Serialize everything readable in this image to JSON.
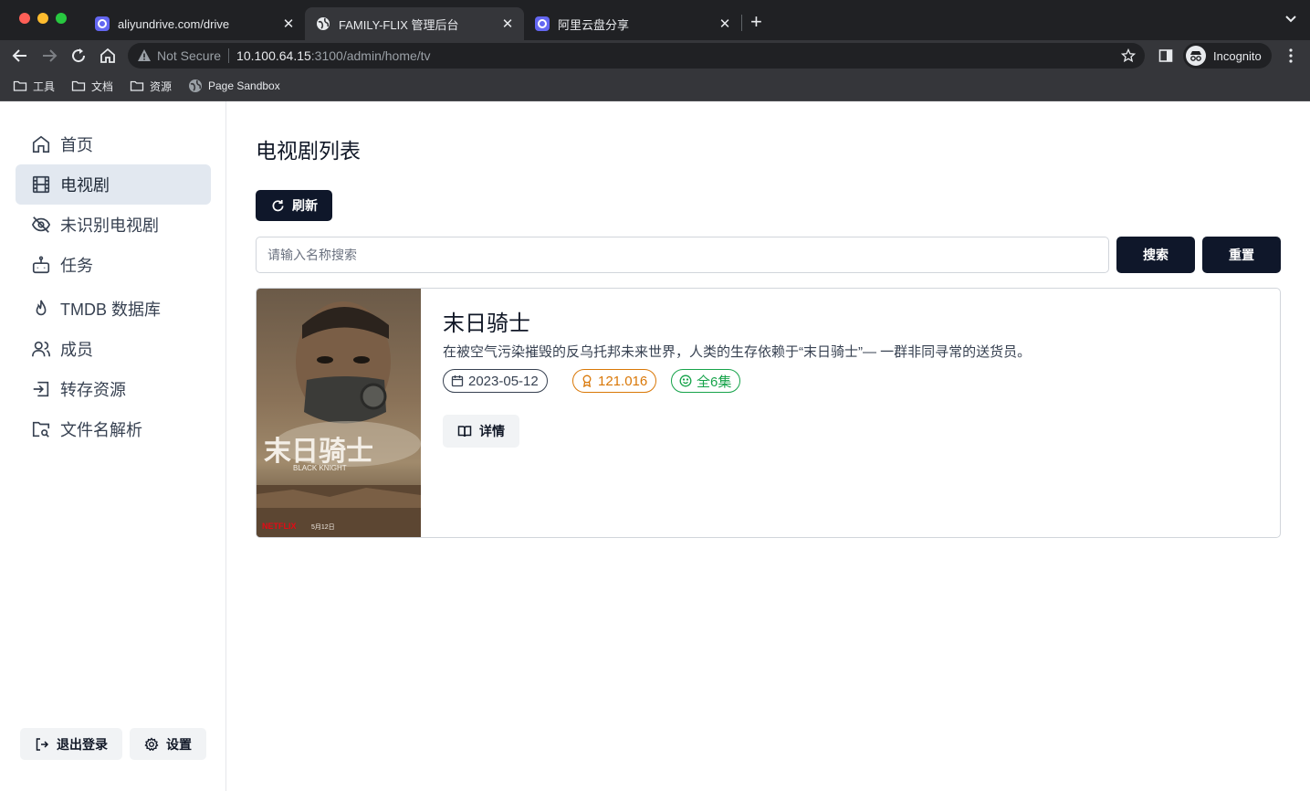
{
  "browser": {
    "tabs": [
      {
        "label": "aliyundrive.com/drive",
        "close": "✕"
      },
      {
        "label": "FAMILY-FLIX 管理后台",
        "close": "✕"
      },
      {
        "label": "阿里云盘分享",
        "close": "✕"
      }
    ],
    "new_tab": "+",
    "address": {
      "security": "Not Secure",
      "host": "10.100.64.15",
      "path": ":3100/admin/home/tv"
    },
    "profile": "Incognito",
    "bookmarks": [
      "工具",
      "文档",
      "资源",
      "Page Sandbox"
    ]
  },
  "sidebar": {
    "items": [
      {
        "label": "首页",
        "icon": "home-icon"
      },
      {
        "label": "电视剧",
        "icon": "film-icon",
        "active": true
      },
      {
        "label": "未识别电视剧",
        "icon": "eye-off-icon"
      },
      {
        "label": "任务",
        "icon": "bot-icon"
      },
      {
        "label": "TMDB 数据库",
        "icon": "flame-icon"
      },
      {
        "label": "成员",
        "icon": "users-icon"
      },
      {
        "label": "转存资源",
        "icon": "import-icon"
      },
      {
        "label": "文件名解析",
        "icon": "folder-search-icon"
      }
    ],
    "logout_label": "退出登录",
    "settings_label": "设置"
  },
  "main": {
    "title": "电视剧列表",
    "refresh_label": "刷新",
    "search": {
      "placeholder": "请输入名称搜索",
      "value": "",
      "search_label": "搜索",
      "reset_label": "重置"
    },
    "shows": [
      {
        "title": "末日骑士",
        "description": "在被空气污染摧毁的反乌托邦未来世界，人类的生存依赖于“末日骑士”— 一群非同寻常的送货员。",
        "air_date": "2023-05-12",
        "rating": "121.016",
        "episodes": "全6集",
        "detail_label": "详情",
        "poster": {
          "title_cn": "末日骑士",
          "title_en": "BLACK KNIGHT",
          "brand": "NETFLIX",
          "release": "5月12日"
        }
      }
    ]
  },
  "colors": {
    "primary_button": "#0f172a",
    "active_nav": "#e2e8f0",
    "rating": "#d97706",
    "episodes": "#16a34a"
  }
}
